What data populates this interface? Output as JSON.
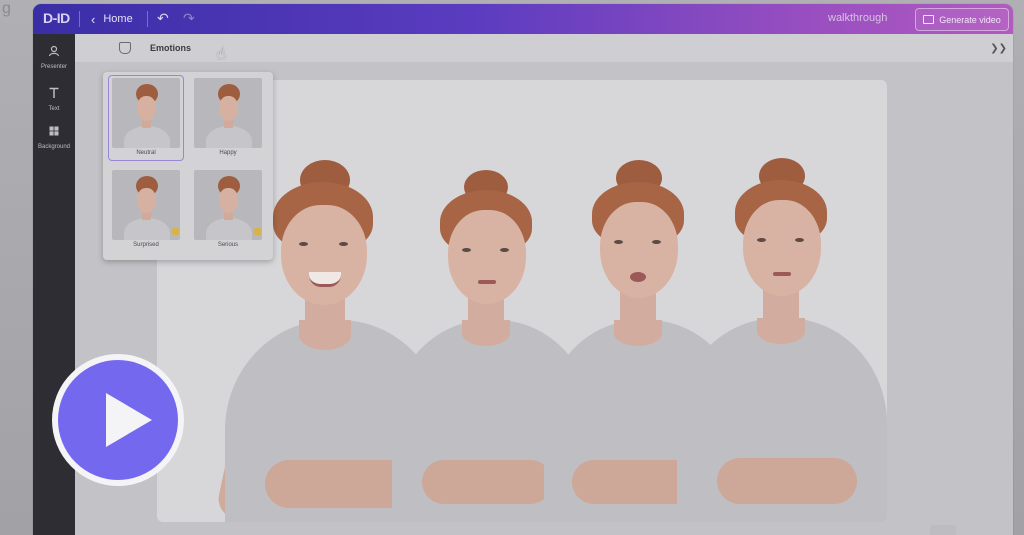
{
  "app": {
    "logo": "D-ID",
    "home_label": "Home",
    "walkthrough_label": "walkthrough",
    "generate_label": "Generate video"
  },
  "sidebar": {
    "items": [
      {
        "label": "Presenter",
        "icon": "person-icon"
      },
      {
        "label": "Text",
        "icon": "text-icon"
      },
      {
        "label": "Background",
        "icon": "background-icon"
      }
    ]
  },
  "toolbar": {
    "emotions_label": "Emotions"
  },
  "emotions": {
    "tiles": [
      {
        "label": "Neutral",
        "selected": true,
        "premium": false
      },
      {
        "label": "Happy",
        "selected": false,
        "premium": false
      },
      {
        "label": "Surprised",
        "selected": false,
        "premium": true
      },
      {
        "label": "Serious",
        "selected": false,
        "premium": true
      }
    ]
  },
  "colors": {
    "accent": "#7468ef",
    "topbar_start": "#3a2ea6",
    "topbar_end": "#b15ac0"
  }
}
